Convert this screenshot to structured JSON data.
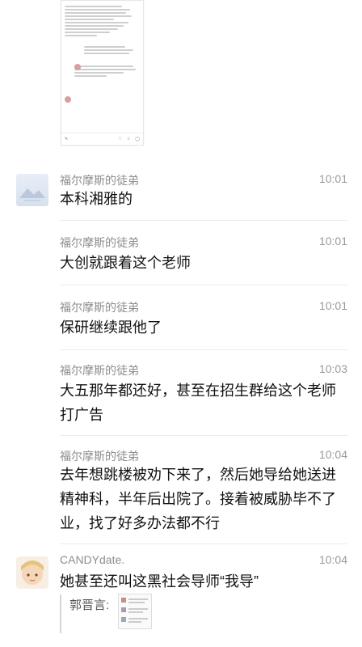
{
  "messages": [
    {
      "name": "福尔摩斯的徒弟",
      "time": "10:01",
      "text": "本科湘雅的"
    },
    {
      "name": "福尔摩斯的徒弟",
      "time": "10:01",
      "text": "大创就跟着这个老师"
    },
    {
      "name": "福尔摩斯的徒弟",
      "time": "10:01",
      "text": "保研继续跟他了"
    },
    {
      "name": "福尔摩斯的徒弟",
      "time": "10:03",
      "text": "大五那年都还好，甚至在招生群给这个老师打广告"
    },
    {
      "name": "福尔摩斯的徒弟",
      "time": "10:04",
      "text": "去年想跳楼被劝下来了，然后她导给她送进精神科，半年后出院了。接着被威胁毕不了业，找了好多办法都不行"
    },
    {
      "name": "CANDYdate.",
      "time": "10:04",
      "text": "她甚至还叫这黑社会导师“我导”"
    }
  ],
  "quote": {
    "label": "郭晋言:"
  }
}
